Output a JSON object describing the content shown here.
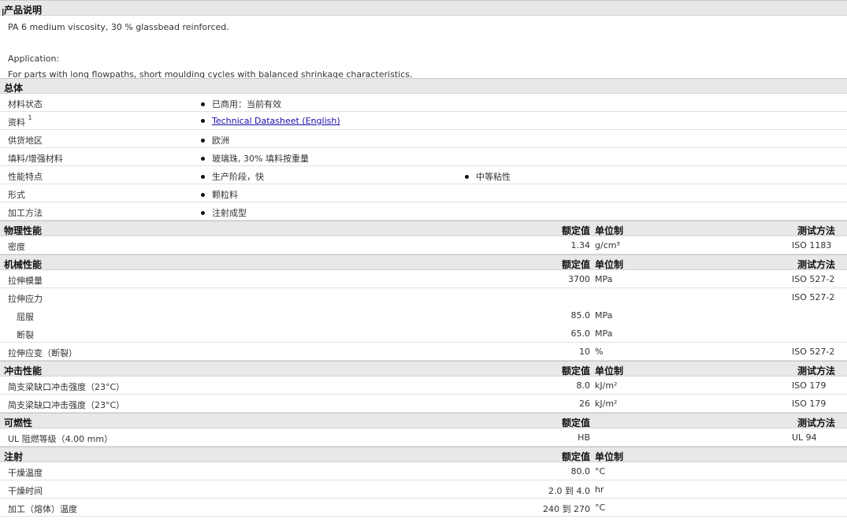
{
  "sections": {
    "product_desc": "产品说明",
    "general": "总体",
    "physical": "物理性能",
    "mechanical": "机械性能",
    "impact": "冲击性能",
    "flammability": "可燃性",
    "injection": "注射"
  },
  "headers": {
    "nominal": "额定值",
    "unit": "单位制",
    "method": "测试方法"
  },
  "description": {
    "line1": "PA 6 medium viscosity, 30 % glassbead reinforced.",
    "line2": "Application:",
    "line3": "For parts with long flowpaths, short moulding cycles with balanced shrinkage characteristics."
  },
  "general": {
    "status_label": "材料状态",
    "status_value": "已商用：当前有效",
    "docs_label": "资料",
    "docs_sup": "1",
    "docs_link": "Technical Datasheet (English)",
    "region_label": "供货地区",
    "region_value": "欧洲",
    "filler_label": "填料/增强材料",
    "filler_value": "玻璃珠, 30% 填料按重量",
    "features_label": "性能特点",
    "features_value1": "生产阶段，快",
    "features_value2": "中等粘性",
    "form_label": "形式",
    "form_value": "颗粒料",
    "process_label": "加工方法",
    "process_value": "注射成型"
  },
  "physical": {
    "density_label": "密度",
    "density_value": "1.34",
    "density_unit": "g/cm³",
    "density_method": "ISO 1183"
  },
  "mechanical": {
    "modulus_label": "拉伸模量",
    "modulus_value": "3700",
    "modulus_unit": "MPa",
    "modulus_method": "ISO 527-2",
    "stress_label": "拉伸应力",
    "stress_method": "ISO 527-2",
    "yield_label": "屈服",
    "yield_value": "85.0",
    "yield_unit": "MPa",
    "break_label": "断裂",
    "break_value": "65.0",
    "break_unit": "MPa",
    "strain_label": "拉伸应变（断裂）",
    "strain_value": "10",
    "strain_unit": "%",
    "strain_method": "ISO 527-2"
  },
  "impact": {
    "r1_label": "简支梁缺口冲击强度（23°C）",
    "r1_value": "8.0",
    "r1_unit": "kJ/m²",
    "r1_method": "ISO 179",
    "r2_label": "简支梁缺口冲击强度（23°C）",
    "r2_value": "26",
    "r2_unit": "kJ/m²",
    "r2_method": "ISO 179"
  },
  "flammability": {
    "ul_label": "UL 阻燃等级（4.00 mm）",
    "ul_value": "HB",
    "ul_method": "UL 94"
  },
  "injection": {
    "dry_temp_label": "干燥温度",
    "dry_temp_value": "80.0",
    "dry_temp_unit": "°C",
    "dry_time_label": "干燥时间",
    "dry_time_value": "2.0 到  4.0",
    "dry_time_unit": "hr",
    "melt_label": "加工（熔体）温度",
    "melt_value": "240 到  270",
    "melt_unit": "°C"
  }
}
